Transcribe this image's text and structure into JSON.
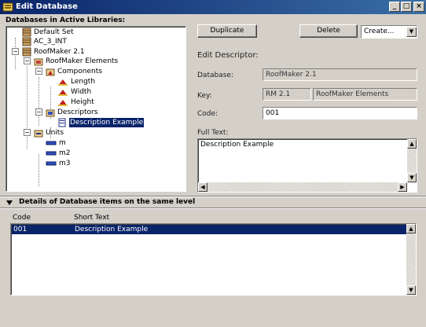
{
  "window": {
    "title": "Edit Database"
  },
  "left_panel": {
    "label": "Databases in Active Libraries:"
  },
  "tree": {
    "default_set": "Default Set",
    "ac_int": "AC_3_INT",
    "roofmaker": "RoofMaker 2.1",
    "roofmaker_elements": "RoofMaker Elements",
    "components": "Components",
    "length": "Length",
    "width": "Width",
    "height": "Height",
    "descriptors": "Descriptors",
    "description_example": "Description Example",
    "units": "Units",
    "m": "m",
    "m2": "m2",
    "m3": "m3"
  },
  "toolbar": {
    "duplicate_label": "Duplicate",
    "delete_label": "Delete",
    "create_label": "Create..."
  },
  "editor": {
    "heading": "Edit Descriptor:",
    "database_label": "Database:",
    "database_value": "RoofMaker 2.1",
    "key_label": "Key:",
    "key_code": "RM 2.1",
    "key_name": "RoofMaker Elements",
    "code_label": "Code:",
    "code_value": "001",
    "fulltext_label": "Full Text:",
    "fulltext_value": "Description Example"
  },
  "details": {
    "header": "Details of Database items on the same level",
    "columns": {
      "code": "Code",
      "short_text": "Short Text"
    },
    "rows": [
      {
        "code": "001",
        "short_text": "Description Example"
      }
    ]
  }
}
